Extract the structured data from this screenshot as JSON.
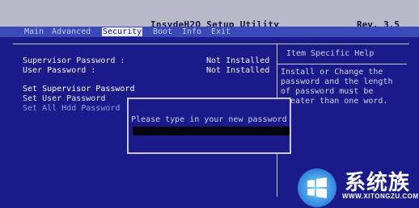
{
  "header": {
    "title": "InsydeH2O Setup Utility",
    "revision": "Rev. 3.5"
  },
  "tabs": [
    {
      "label": "Main",
      "active": false
    },
    {
      "label": "Advanced",
      "active": false
    },
    {
      "label": "Security",
      "active": true
    },
    {
      "label": "Boot",
      "active": false
    },
    {
      "label": "Info",
      "active": false
    },
    {
      "label": "Exit",
      "active": false
    }
  ],
  "status": {
    "supervisor_label": "Supervisor Password :",
    "supervisor_value": "Not Installed",
    "user_label": "User Password        :",
    "user_value": "Not Installed"
  },
  "menu": [
    {
      "label": "Set Supervisor Password",
      "state": "highlight"
    },
    {
      "label": "Set User Password",
      "state": "normal"
    },
    {
      "label": "Set All Hdd Password",
      "state": "dim"
    }
  ],
  "help": {
    "title": "Item Specific Help",
    "body": "Install or Change the\npassword and the length\nof password must be\ngreater than one word."
  },
  "dialog": {
    "prompt": "Please type in your new password",
    "value": ""
  },
  "watermark": {
    "text": "系统族",
    "url": "WWW.XITONGZU.COM"
  }
}
